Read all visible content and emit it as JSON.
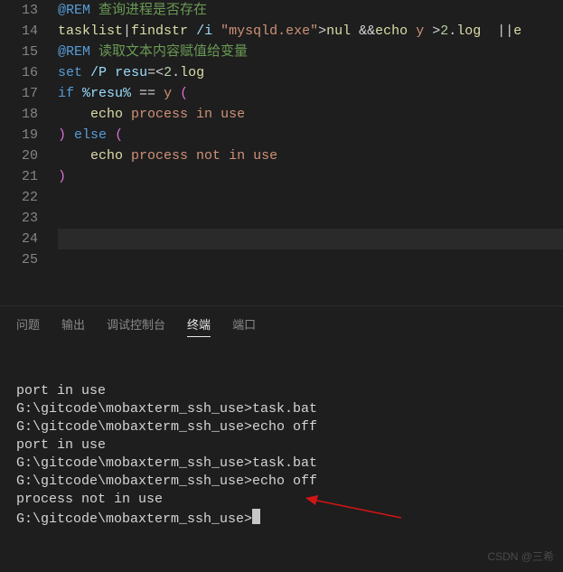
{
  "editor": {
    "first_line": 13,
    "active_line": 24,
    "lines": [
      [
        [
          "rem",
          "@REM"
        ],
        [
          "op",
          " "
        ],
        [
          "comment",
          "查询进程是否存在"
        ]
      ],
      [
        [
          "cmd",
          "tasklist"
        ],
        [
          "op",
          "|"
        ],
        [
          "cmd",
          "findstr"
        ],
        [
          "op",
          " "
        ],
        [
          "opt",
          "/i"
        ],
        [
          "op",
          " "
        ],
        [
          "str",
          "\"mysqld.exe\""
        ],
        [
          "op",
          ">"
        ],
        [
          "cmd",
          "nul"
        ],
        [
          "op",
          " &&"
        ],
        [
          "cmd",
          "echo"
        ],
        [
          "op",
          " "
        ],
        [
          "text",
          "y"
        ],
        [
          "op",
          " >"
        ],
        [
          "num",
          "2"
        ],
        [
          "op",
          "."
        ],
        [
          "cmd",
          "log"
        ],
        [
          "op",
          "  ||"
        ],
        [
          "cmd",
          "e"
        ]
      ],
      [
        [
          "rem",
          "@REM"
        ],
        [
          "op",
          " "
        ],
        [
          "comment",
          "读取文本内容赋值给变量"
        ]
      ],
      [
        [
          "key",
          "set"
        ],
        [
          "op",
          " "
        ],
        [
          "opt",
          "/P"
        ],
        [
          "op",
          " "
        ],
        [
          "var",
          "resu"
        ],
        [
          "op",
          "=<"
        ],
        [
          "num",
          "2"
        ],
        [
          "op",
          "."
        ],
        [
          "cmd",
          "log"
        ]
      ],
      [
        [
          "key",
          "if"
        ],
        [
          "op",
          " "
        ],
        [
          "var",
          "%resu%"
        ],
        [
          "op",
          " == "
        ],
        [
          "text",
          "y"
        ],
        [
          "op",
          " "
        ],
        [
          "paren",
          "("
        ]
      ],
      [
        [
          "op",
          "    "
        ],
        [
          "cmd",
          "echo"
        ],
        [
          "op",
          " "
        ],
        [
          "text",
          "process in use"
        ]
      ],
      [
        [
          "paren",
          ")"
        ],
        [
          "op",
          " "
        ],
        [
          "key",
          "else"
        ],
        [
          "op",
          " "
        ],
        [
          "paren",
          "("
        ]
      ],
      [
        [
          "op",
          "    "
        ],
        [
          "cmd",
          "echo"
        ],
        [
          "op",
          " "
        ],
        [
          "text",
          "process not in use"
        ]
      ],
      [
        [
          "paren",
          ")"
        ]
      ],
      [],
      [],
      [],
      []
    ]
  },
  "tabs": {
    "items": [
      "问题",
      "输出",
      "调试控制台",
      "终端",
      "端口"
    ],
    "active": 3
  },
  "terminal": {
    "lines": [
      "port in use",
      "G:\\gitcode\\mobaxterm_ssh_use>task.bat",
      "",
      "G:\\gitcode\\mobaxterm_ssh_use>echo off",
      "port in use",
      "G:\\gitcode\\mobaxterm_ssh_use>task.bat",
      "",
      "G:\\gitcode\\mobaxterm_ssh_use>echo off",
      "process not in use"
    ],
    "prompt": "G:\\gitcode\\mobaxterm_ssh_use>"
  },
  "watermark": "CSDN @三希"
}
